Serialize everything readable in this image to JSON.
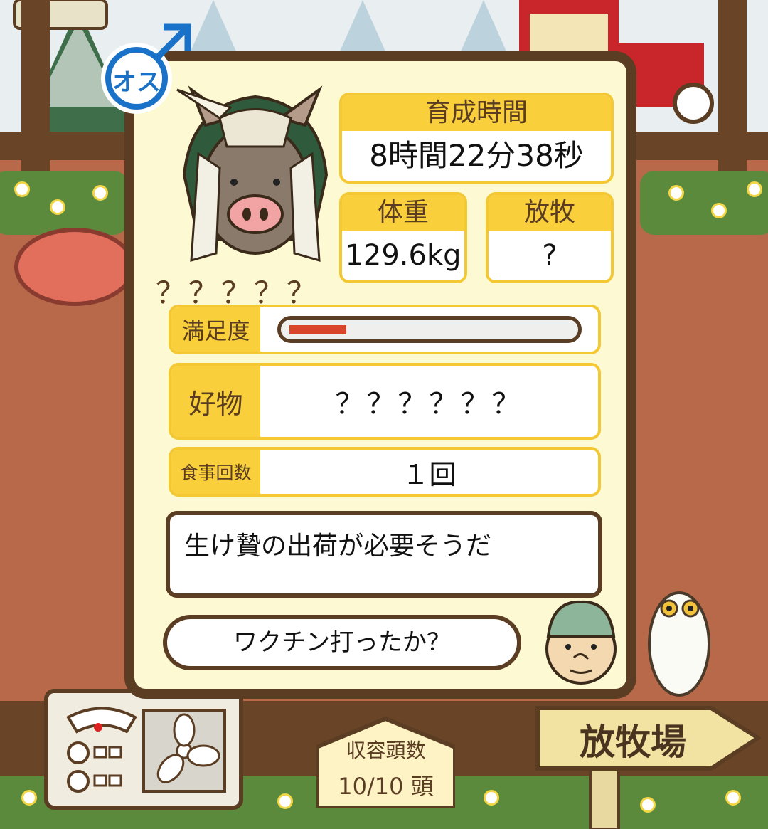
{
  "gender_badge": {
    "label": "オス",
    "color": "#1a72c8"
  },
  "stats": {
    "growth_time": {
      "label": "育成時間",
      "value": "8時間22分38秒"
    },
    "weight": {
      "label": "体重",
      "value": "129.6kg"
    },
    "grazing": {
      "label": "放牧",
      "value": "?"
    }
  },
  "boar_name": "？？？？？",
  "satisfaction": {
    "label": "満足度",
    "level_fraction": 0.2,
    "fill_color": "#d9452a"
  },
  "favorite": {
    "label": "好物",
    "value": "？？？？？？"
  },
  "meal_count": {
    "label": "食事回数",
    "value": "１回"
  },
  "messages": {
    "main": "生け贄の出荷が必要そうだ",
    "question": "ワクチン打ったか？"
  },
  "capacity": {
    "label": "収容頭数",
    "value": "10/10 頭"
  },
  "sign": {
    "label": "放牧場"
  },
  "colors": {
    "panel_border": "#5a3d22",
    "panel_bg": "#fdf9d3",
    "accent_yellow": "#f9cf3c"
  }
}
